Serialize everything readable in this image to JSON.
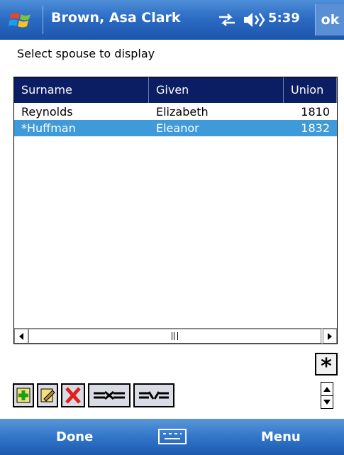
{
  "titlebar": {
    "title": "Brown, Asa Clark",
    "time": "5:39",
    "ok_label": "ok"
  },
  "prompt": "Select spouse to display",
  "list": {
    "columns": [
      "Surname",
      "Given",
      "Union"
    ],
    "rows": [
      {
        "surname": "Reynolds",
        "given": "Elizabeth",
        "union": "1810",
        "selected": false
      },
      {
        "surname": "*Huffman",
        "given": "Eleanor",
        "union": "1832",
        "selected": true
      }
    ]
  },
  "star_button_label": "*",
  "menubar": {
    "left": "Done",
    "right": "Menu"
  },
  "colors": {
    "titlebar": "#2c6cc4",
    "header": "#0b1d63",
    "selection": "#3f9ad9"
  }
}
